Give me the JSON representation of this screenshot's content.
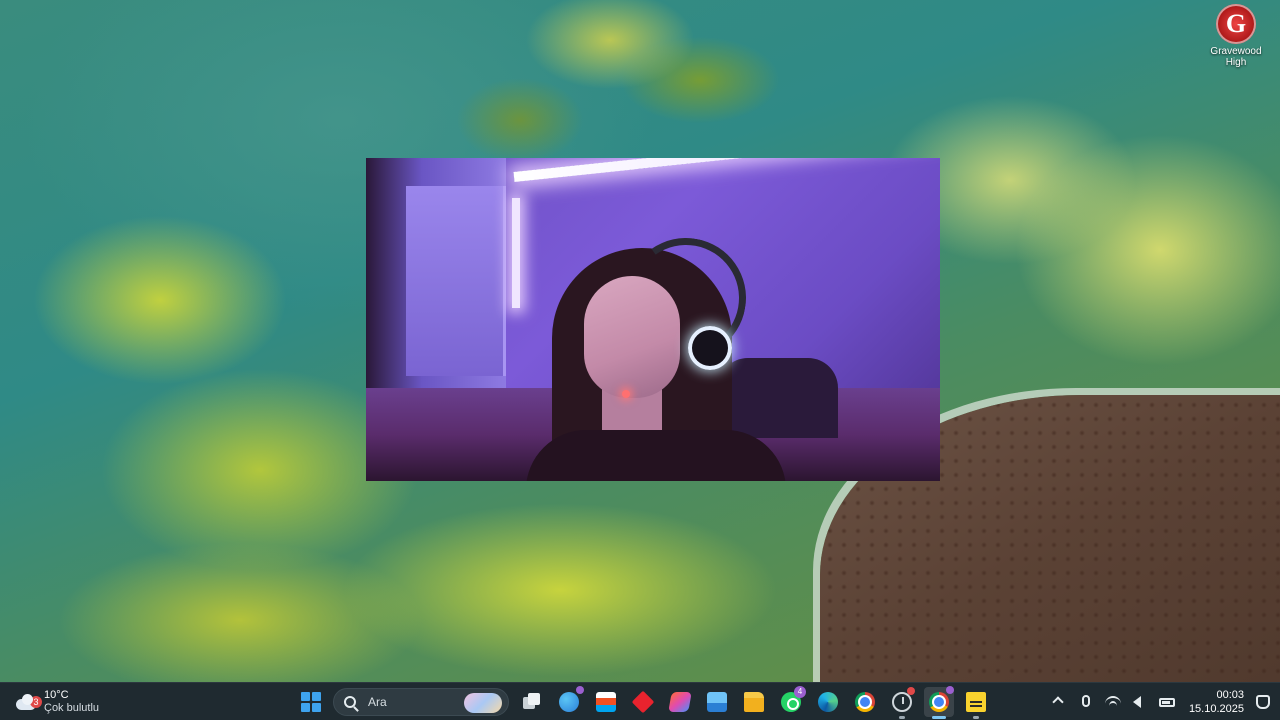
{
  "desktop": {
    "icon_label": "Gravewood High",
    "icon_glyph": "G"
  },
  "camera_window": {
    "description_type": "webcam-preview"
  },
  "taskbar": {
    "weather": {
      "badge_count": "3",
      "temperature": "10°C",
      "condition": "Çok bulutlu"
    },
    "search": {
      "placeholder": "Ara"
    },
    "apps": [
      {
        "name": "start",
        "icon": "windows-logo"
      },
      {
        "name": "task-view",
        "icon": "task-view-icon"
      },
      {
        "name": "copilot",
        "icon": "copilot-icon",
        "badge": ""
      },
      {
        "name": "microsoft-store",
        "icon": "store-icon"
      },
      {
        "name": "red-diamond-app",
        "icon": "diamond-icon"
      },
      {
        "name": "office",
        "icon": "office-icon"
      },
      {
        "name": "photos",
        "icon": "photos-icon"
      },
      {
        "name": "file-explorer",
        "icon": "folder-icon"
      },
      {
        "name": "whatsapp",
        "icon": "whatsapp-icon",
        "badge": "4"
      },
      {
        "name": "edge",
        "icon": "edge-icon"
      },
      {
        "name": "chrome",
        "icon": "chrome-icon"
      },
      {
        "name": "clock-app",
        "icon": "clock-icon"
      },
      {
        "name": "chrome-profile",
        "icon": "chrome-icon",
        "badge": ""
      },
      {
        "name": "sticky-notes",
        "icon": "sticky-notes-icon"
      }
    ],
    "clock": {
      "time": "00:03",
      "date": "15.10.2025"
    }
  },
  "colors": {
    "taskbar_bg": "#1f2a30",
    "accent": "#3ea3ee",
    "badge_purple": "#9b5fd0",
    "badge_red": "#e04848"
  }
}
